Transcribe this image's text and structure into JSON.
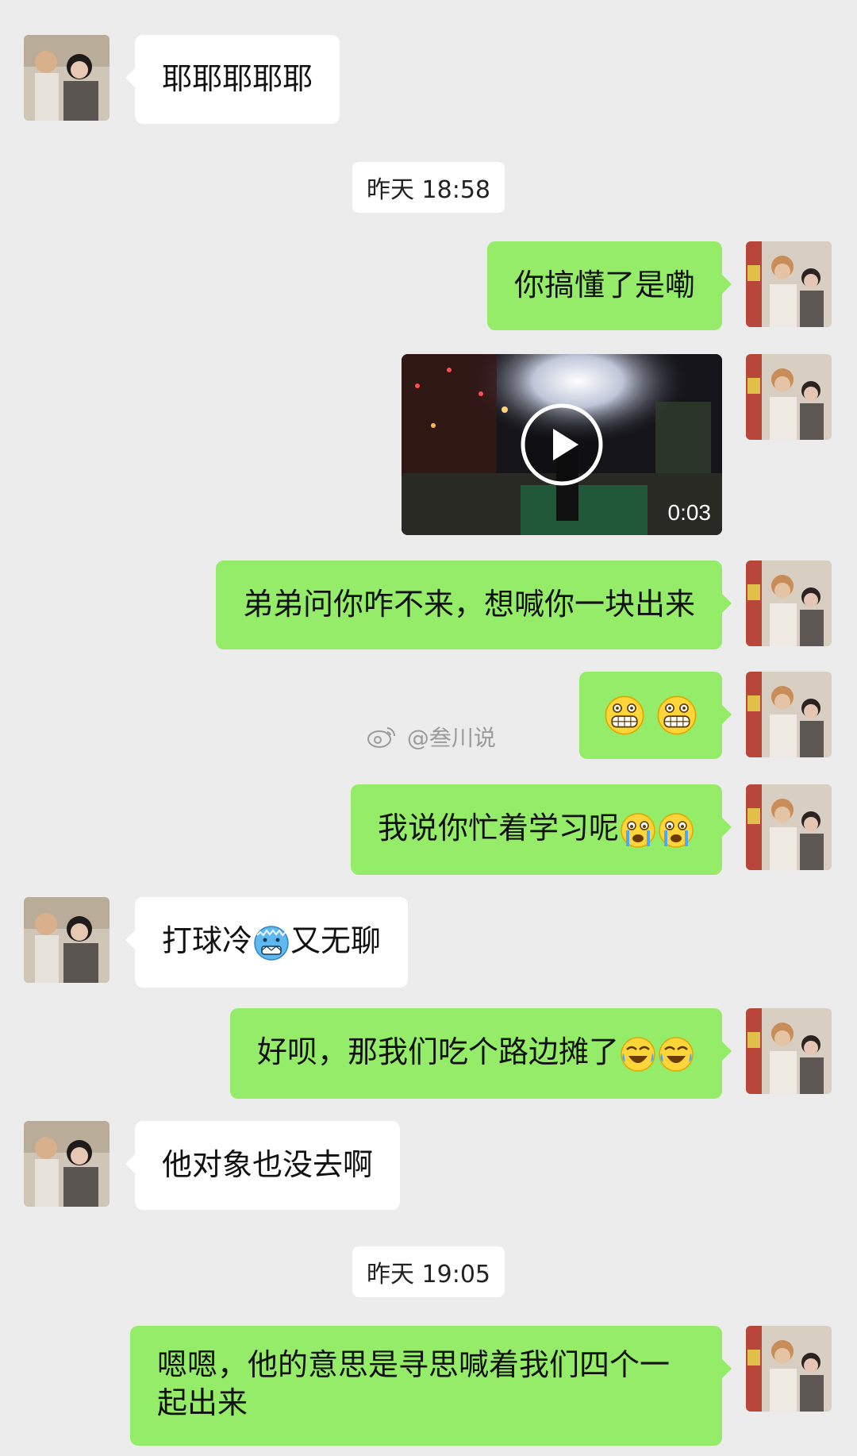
{
  "watermark": "@叁川说",
  "messages": {
    "m1_text": "耶耶耶耶耶",
    "t1": "昨天 18:58",
    "m2_text": "你搞懂了是嘞",
    "video_duration": "0:03",
    "m3_text": "弟弟问你咋不来，想喊你一块出来",
    "m5_text": "我说你忙着学习呢",
    "m6_text_a": "打球冷",
    "m6_text_b": "又无聊",
    "m7_text": "好呗，那我们吃个路边摊了",
    "m8_text": "他对象也没去啊",
    "t2": "昨天 19:05",
    "m9_text": "嗯嗯，他的意思是寻思喊着我们四个一起出来"
  },
  "emojis": {
    "grin": "grinning-face-icon",
    "crying": "crying-face-icon",
    "cold": "cold-face-icon",
    "laugh_cry": "laughing-crying-face-icon"
  },
  "colors": {
    "background": "#ececec",
    "incoming_bubble": "#ffffff",
    "outgoing_bubble": "#95ec69",
    "timestamp_bg": "#ffffff"
  }
}
